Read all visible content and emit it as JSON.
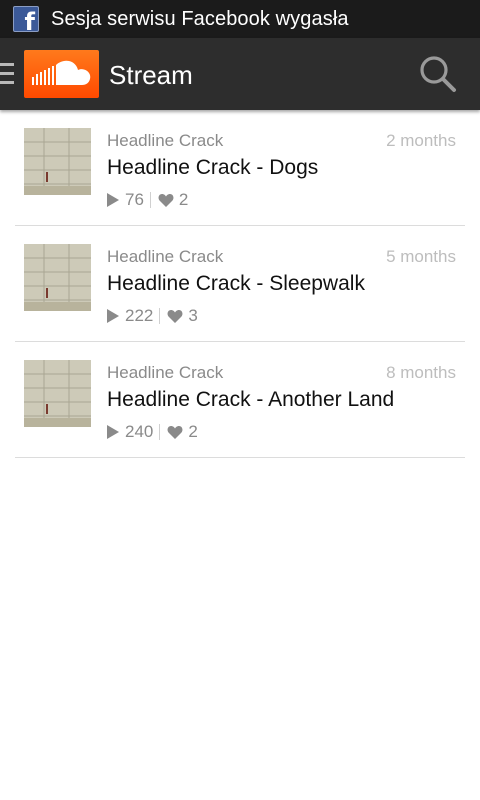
{
  "status_bar": {
    "notification_icon": "facebook-icon",
    "notification_text": "Sesja serwisu Facebook wygasła"
  },
  "action_bar": {
    "title": "Stream",
    "icons": {
      "menu": "menu-icon",
      "logo": "soundcloud-logo",
      "search": "search-icon"
    },
    "colors": {
      "bar": "#2d2d2d",
      "logo_orange": "#ff5500"
    }
  },
  "stream": {
    "items": [
      {
        "artist": "Headline Crack",
        "title": "Headline Crack - Dogs",
        "age": "2 months",
        "plays": "76",
        "likes": "2"
      },
      {
        "artist": "Headline Crack",
        "title": "Headline Crack - Sleepwalk",
        "age": "5 months",
        "plays": "222",
        "likes": "3"
      },
      {
        "artist": "Headline Crack",
        "title": "Headline Crack - Another Land",
        "age": "8 months",
        "plays": "240",
        "likes": "2"
      }
    ]
  }
}
